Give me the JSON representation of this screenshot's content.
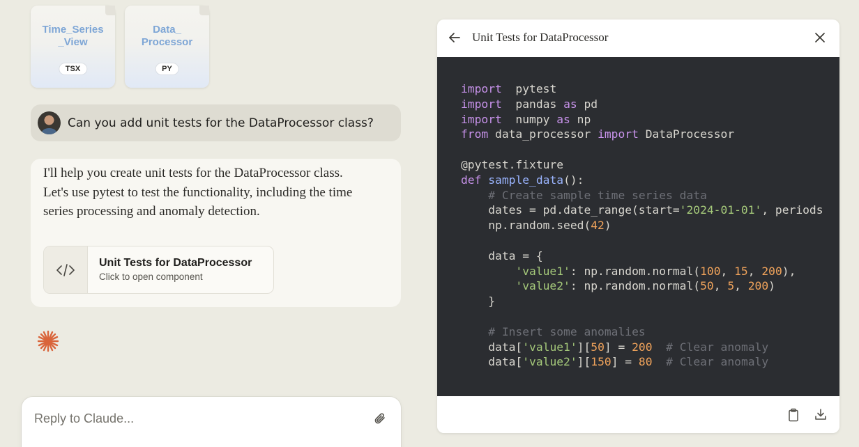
{
  "files": [
    {
      "name": "Time_Series\n_View",
      "type": "TSX"
    },
    {
      "name": "Data_\nProcessor",
      "type": "PY"
    }
  ],
  "user_message": "Can you add unit tests for the DataProcessor class?",
  "assistant_message": "I'll help you create unit tests for the DataProcessor class. Let's use pytest to test the functionality, including the time series processing and anomaly detection.",
  "artifact_card": {
    "title": "Unit Tests for DataProcessor",
    "subtitle": "Click to open component"
  },
  "reply": {
    "placeholder": "Reply to Claude..."
  },
  "panel": {
    "title": "Unit Tests for DataProcessor",
    "code_lines": [
      [
        [
          "kw",
          "import"
        ],
        [
          "",
          "  pytest"
        ]
      ],
      [
        [
          "kw",
          "import"
        ],
        [
          "",
          "  pandas "
        ],
        [
          "kw",
          "as"
        ],
        [
          "",
          " pd"
        ]
      ],
      [
        [
          "kw",
          "import"
        ],
        [
          "",
          "  numpy "
        ],
        [
          "kw",
          "as"
        ],
        [
          "",
          " np"
        ]
      ],
      [
        [
          "kw",
          "from"
        ],
        [
          "",
          " data_processor "
        ],
        [
          "kw",
          "import"
        ],
        [
          "",
          " DataProcessor"
        ]
      ],
      [],
      [
        [
          "",
          "@pytest.fixture"
        ]
      ],
      [
        [
          "kw",
          "def"
        ],
        [
          "",
          " "
        ],
        [
          "fn",
          "sample_data"
        ],
        [
          "",
          "():"
        ]
      ],
      [
        [
          "",
          "    "
        ],
        [
          "cm",
          "# Create sample time series data"
        ]
      ],
      [
        [
          "",
          "    dates = pd.date_range(start="
        ],
        [
          "str",
          "'2024-01-01'"
        ],
        [
          "",
          ", periods"
        ]
      ],
      [
        [
          "",
          "    np.random.seed("
        ],
        [
          "num",
          "42"
        ],
        [
          "",
          ")"
        ]
      ],
      [],
      [
        [
          "",
          "    data = {"
        ]
      ],
      [
        [
          "",
          "        "
        ],
        [
          "str",
          "'value1'"
        ],
        [
          "",
          ": np.random.normal("
        ],
        [
          "num",
          "100"
        ],
        [
          "",
          ", "
        ],
        [
          "num",
          "15"
        ],
        [
          "",
          ", "
        ],
        [
          "num",
          "200"
        ],
        [
          "",
          "),"
        ]
      ],
      [
        [
          "",
          "        "
        ],
        [
          "str",
          "'value2'"
        ],
        [
          "",
          ": np.random.normal("
        ],
        [
          "num",
          "50"
        ],
        [
          "",
          ", "
        ],
        [
          "num",
          "5"
        ],
        [
          "",
          ", "
        ],
        [
          "num",
          "200"
        ],
        [
          "",
          ")"
        ]
      ],
      [
        [
          "",
          "    }"
        ]
      ],
      [],
      [
        [
          "",
          "    "
        ],
        [
          "cm",
          "# Insert some anomalies"
        ]
      ],
      [
        [
          "",
          "    data["
        ],
        [
          "str",
          "'value1'"
        ],
        [
          "",
          "]["
        ],
        [
          "num",
          "50"
        ],
        [
          "",
          "] = "
        ],
        [
          "num",
          "200"
        ],
        [
          "",
          "  "
        ],
        [
          "cm",
          "# Clear anomaly"
        ]
      ],
      [
        [
          "",
          "    data["
        ],
        [
          "str",
          "'value2'"
        ],
        [
          "",
          "]["
        ],
        [
          "num",
          "150"
        ],
        [
          "",
          "] = "
        ],
        [
          "num",
          "80"
        ],
        [
          "",
          "  "
        ],
        [
          "cm",
          "# Clear anomaly"
        ]
      ]
    ]
  },
  "icons": {
    "code": "code-brackets-icon",
    "attach": "paperclip-icon",
    "back": "arrow-left-icon",
    "close": "close-icon",
    "copy": "clipboard-icon",
    "download": "download-icon",
    "spark": "claude-spark-icon"
  },
  "colors": {
    "background": "#ecebe2",
    "code_bg": "#2b2d31",
    "accent": "#d9653b",
    "file_name": "#7ea6d6"
  }
}
